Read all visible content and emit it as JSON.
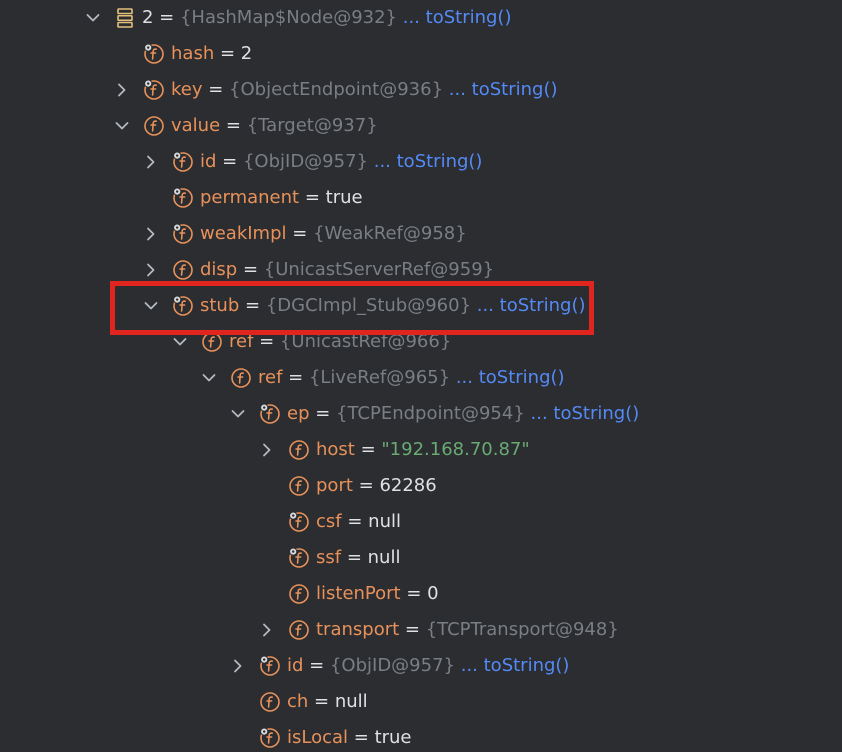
{
  "colors": {
    "background": "#2b2d30",
    "field_name": "#e8915a",
    "type_gray": "#7a7e85",
    "link_blue": "#548af7",
    "string_green": "#6aab73",
    "highlight_red": "#e0251f",
    "field_icon_orange": "#e8915a"
  },
  "tree": [
    {
      "name": "2",
      "eq": " = ",
      "value": "{HashMap$Node@932}",
      "value_kind": "type",
      "link": "toString()",
      "dots": "... ",
      "expand": "expanded",
      "icon": "array-node-icon",
      "indent": 0
    },
    {
      "name": "hash",
      "eq": " = ",
      "value": "2",
      "value_kind": "plain",
      "link": "",
      "expand": "none",
      "icon": "field-final-icon",
      "indent": 1
    },
    {
      "name": "key",
      "eq": " = ",
      "value": "{ObjectEndpoint@936}",
      "value_kind": "type",
      "link": "toString()",
      "dots": "... ",
      "expand": "collapsed",
      "icon": "field-final-icon",
      "indent": 1
    },
    {
      "name": "value",
      "eq": " = ",
      "value": "{Target@937}",
      "value_kind": "type",
      "link": "",
      "expand": "expanded",
      "icon": "field-icon",
      "indent": 1
    },
    {
      "name": "id",
      "eq": " = ",
      "value": "{ObjID@957}",
      "value_kind": "type",
      "link": "toString()",
      "dots": "... ",
      "expand": "collapsed",
      "icon": "field-final-icon",
      "indent": 2
    },
    {
      "name": "permanent",
      "eq": " = ",
      "value": "true",
      "value_kind": "plain",
      "link": "",
      "expand": "none",
      "icon": "field-final-icon",
      "indent": 2
    },
    {
      "name": "weakImpl",
      "eq": " = ",
      "value": "{WeakRef@958}",
      "value_kind": "type",
      "link": "",
      "expand": "collapsed",
      "icon": "field-final-icon",
      "indent": 2
    },
    {
      "name": "disp",
      "eq": " = ",
      "value": "{UnicastServerRef@959}",
      "value_kind": "type",
      "link": "",
      "expand": "collapsed",
      "icon": "field-icon",
      "indent": 2
    },
    {
      "name": "stub",
      "eq": " = ",
      "value": "{DGCImpl_Stub@960}",
      "value_kind": "type",
      "link": "toString()",
      "dots": "... ",
      "expand": "expanded",
      "icon": "field-final-icon",
      "indent": 2
    },
    {
      "name": "ref",
      "eq": " = ",
      "value": "{UnicastRef@966}",
      "value_kind": "type",
      "link": "",
      "expand": "expanded",
      "icon": "field-icon",
      "indent": 3
    },
    {
      "name": "ref",
      "eq": " = ",
      "value": "{LiveRef@965}",
      "value_kind": "type",
      "link": "toString()",
      "dots": "... ",
      "expand": "expanded",
      "icon": "field-icon",
      "indent": 4
    },
    {
      "name": "ep",
      "eq": " = ",
      "value": "{TCPEndpoint@954}",
      "value_kind": "type",
      "link": "toString()",
      "dots": "... ",
      "expand": "expanded",
      "icon": "field-final-icon",
      "indent": 5
    },
    {
      "name": "host",
      "eq": " = ",
      "value": "\"192.168.70.87\"",
      "value_kind": "string",
      "link": "",
      "expand": "collapsed",
      "icon": "field-icon",
      "indent": 6
    },
    {
      "name": "port",
      "eq": " = ",
      "value": "62286",
      "value_kind": "plain",
      "link": "",
      "expand": "none",
      "icon": "field-icon",
      "indent": 6
    },
    {
      "name": "csf",
      "eq": " = ",
      "value": "null",
      "value_kind": "plain",
      "link": "",
      "expand": "none",
      "icon": "field-final-icon",
      "indent": 6
    },
    {
      "name": "ssf",
      "eq": " = ",
      "value": "null",
      "value_kind": "plain",
      "link": "",
      "expand": "none",
      "icon": "field-final-icon",
      "indent": 6
    },
    {
      "name": "listenPort",
      "eq": " = ",
      "value": "0",
      "value_kind": "plain",
      "link": "",
      "expand": "none",
      "icon": "field-icon",
      "indent": 6
    },
    {
      "name": "transport",
      "eq": " = ",
      "value": "{TCPTransport@948}",
      "value_kind": "type",
      "link": "",
      "expand": "collapsed",
      "icon": "field-icon",
      "indent": 6
    },
    {
      "name": "id",
      "eq": " = ",
      "value": "{ObjID@957}",
      "value_kind": "type",
      "link": "toString()",
      "dots": "... ",
      "expand": "collapsed",
      "icon": "field-final-icon",
      "indent": 5
    },
    {
      "name": "ch",
      "eq": " = ",
      "value": "null",
      "value_kind": "plain",
      "link": "",
      "expand": "none",
      "icon": "field-icon",
      "indent": 5
    },
    {
      "name": "isLocal",
      "eq": " = ",
      "value": "true",
      "value_kind": "plain",
      "link": "",
      "expand": "none",
      "icon": "field-final-icon",
      "indent": 5
    }
  ]
}
